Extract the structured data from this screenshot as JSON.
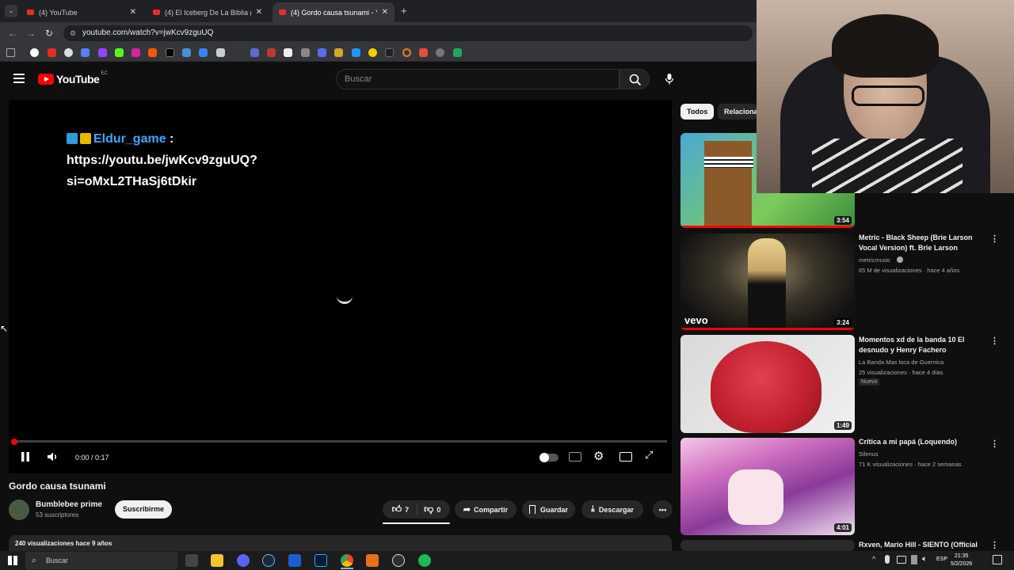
{
  "browser": {
    "tabs": [
      {
        "label": "(4) YouTube",
        "active": false
      },
      {
        "label": "(4) El Iceberg De La Biblia (Pt. 2",
        "active": false
      },
      {
        "label": "(4) Gordo causa tsunami - You",
        "active": true
      }
    ],
    "url": "youtube.com/watch?v=jwKcv9zguUQ"
  },
  "header": {
    "logo": "YouTube",
    "country": "EC",
    "search_placeholder": "Buscar"
  },
  "player": {
    "chat_user": "Eldur_game",
    "chat_colon": ":",
    "chat_line1": "https://youtu.be/jwKcv9zguUQ?",
    "chat_line2": "si=oMxL2THaSj6tDkir",
    "time": "0:00 / 0:17",
    "progress": 0.0
  },
  "video": {
    "title": "Gordo causa tsunami",
    "channel": "Bumblebee prime",
    "subscribers": "53 suscriptores",
    "subscribe_label": "Suscribirme",
    "likes": "7",
    "dislikes": "0",
    "share_label": "Compartir",
    "save_label": "Guardar",
    "download_label": "Descargar",
    "views_date": "240 visualizaciones  hace 9 años"
  },
  "sidebar": {
    "chips": [
      "Todos",
      "Relaciona"
    ],
    "items": [
      {
        "title": "",
        "channel": "",
        "meta": "",
        "duration": "3:54"
      },
      {
        "title": "Metric - Black Sheep (Brie Larson Vocal Version) ft. Brie Larson",
        "channel": "metricmusic",
        "meta": "65 M de visualizaciones · hace 4 años",
        "duration": "3:24",
        "watermark": "vevo"
      },
      {
        "title": "Momentos xd de la banda 10 El desnudo y Henry Fachero",
        "channel": "La Banda Mas loca de Guernica",
        "meta": "25 visualizaciones · hace 4 días",
        "duration": "1:49",
        "badge": "Nuevo"
      },
      {
        "title": "Crítica a mi papá (Loquendo)",
        "channel": "Silenus",
        "meta": "71 K visualizaciones · hace 2 semanas",
        "duration": "4:01"
      },
      {
        "title": "Rxven, Mario Hill - SIENTO (Official",
        "channel": "",
        "meta": "",
        "duration": ""
      }
    ]
  },
  "taskbar": {
    "search": "Buscar",
    "lang": "ESP",
    "time": "21:35",
    "date": "5/2/2026"
  },
  "colors": {
    "accent": "#ff0000",
    "link": "#3ea6ff",
    "background": "#0f0f0f"
  }
}
